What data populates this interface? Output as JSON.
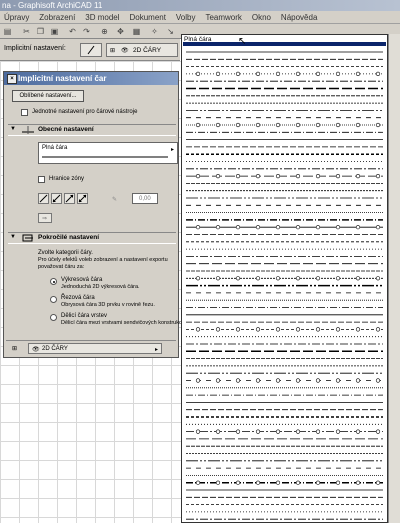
{
  "window": {
    "title": "na - Graphisoft ArchiCAD 11"
  },
  "menu": [
    "Úpravy",
    "Zobrazení",
    "3D model",
    "Dokument",
    "Volby",
    "Teamwork",
    "Okno",
    "Nápověda"
  ],
  "infobar": {
    "label": "Implicitní nastavení:",
    "layer": "2D ČÁRY"
  },
  "dialog": {
    "title": "Implicitní nastavení čar",
    "favorites_button": "Oblíbené nastavení...",
    "independent_checkbox": "Jednotné nastavení pro čárové nástroje",
    "general_section": "Obecné nastavení",
    "line_type": "Plná čára",
    "zone_border": "Hranice zóny",
    "angle_value": "0,00",
    "advanced_section": "Pokročilé nastavení",
    "category_heading": "Zvolte kategorii čáry.",
    "category_help": [
      "Pro účely efektů voleb zobrazení a nastavení exportu",
      "považovat čáru za:"
    ],
    "categories": [
      {
        "label": "Výkresová čára",
        "desc": "Jednoduchá 2D výkresová čára.",
        "selected": true
      },
      {
        "label": "Řezová čára",
        "desc": "Obrysová čára 3D prvku v rovině řezu.",
        "selected": false
      },
      {
        "label": "Dělicí čára vrstev",
        "desc": "Dělicí čára mezi vrstvami sendvičových konstrukcí.",
        "selected": false
      }
    ],
    "layer": "2D ČÁRY"
  },
  "dropdown": {
    "selected": "Plná čára"
  }
}
